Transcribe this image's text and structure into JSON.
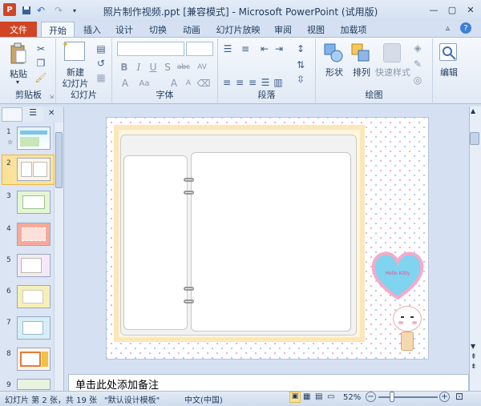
{
  "window": {
    "title": "照片制作视频.ppt [兼容模式] - Microsoft PowerPoint (试用版)"
  },
  "qat": {
    "undo_icon": "↶",
    "redo_icon": "↷"
  },
  "tabs": [
    {
      "label": "文件"
    },
    {
      "label": "开始"
    },
    {
      "label": "插入"
    },
    {
      "label": "设计"
    },
    {
      "label": "切换"
    },
    {
      "label": "动画"
    },
    {
      "label": "幻灯片放映"
    },
    {
      "label": "审阅"
    },
    {
      "label": "视图"
    },
    {
      "label": "加载项"
    }
  ],
  "ribbon": {
    "clipboard": {
      "label": "剪贴板",
      "paste": "粘贴"
    },
    "slides": {
      "label": "幻灯片",
      "new_slide_line1": "新建",
      "new_slide_line2": "幻灯片"
    },
    "font": {
      "label": "字体"
    },
    "paragraph": {
      "label": "段落"
    },
    "drawing": {
      "label": "绘图",
      "shape": "形状",
      "arrange": "排列",
      "quick_styles": "快速样式"
    },
    "editing": {
      "label": "编辑"
    }
  },
  "slide_numbers": [
    "1",
    "2",
    "3",
    "4",
    "5",
    "6",
    "7",
    "8",
    "9"
  ],
  "slide_decor": {
    "heart_text": "Hello Kitty"
  },
  "notes": {
    "placeholder": "单击此处添加备注"
  },
  "status": {
    "slide_info": "幻灯片 第 2 张，共 19 张",
    "theme": "\"默认设计模板\"",
    "language": "中文(中国)",
    "zoom": "52%",
    "zoom_fraction": 0.52
  }
}
